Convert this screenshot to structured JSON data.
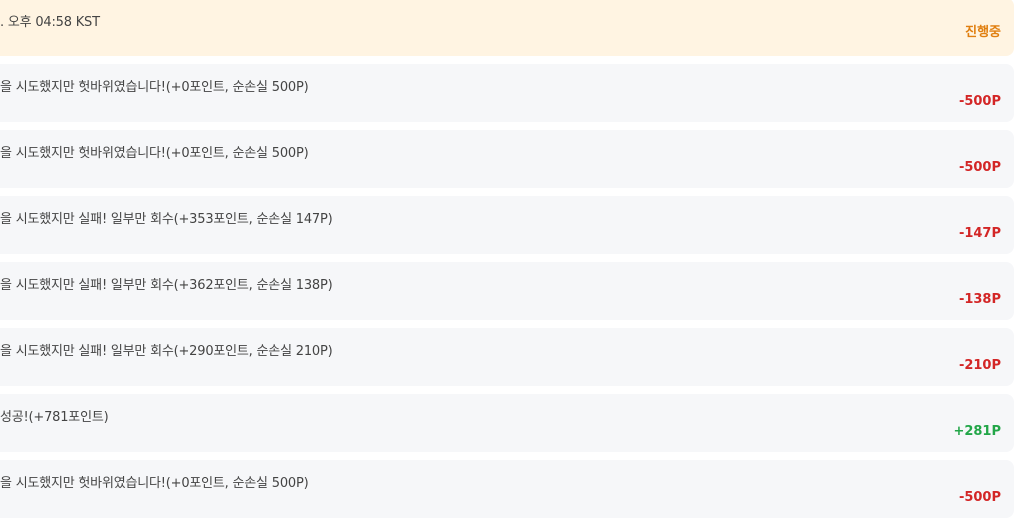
{
  "colors": {
    "status": "#e07f10",
    "negative": "#d32626",
    "positive": "#22a648"
  },
  "header_row": {
    "text": ". 오후 04:58 KST",
    "status": "진행중"
  },
  "history": [
    {
      "text": "을 시도했지만 헛바위였습니다!(+0포인트, 순손실 500P)",
      "delta": "-500P",
      "kind": "negative"
    },
    {
      "text": "을 시도했지만 헛바위였습니다!(+0포인트, 순손실 500P)",
      "delta": "-500P",
      "kind": "negative"
    },
    {
      "text": "을 시도했지만 실패! 일부만 회수(+353포인트, 순손실 147P)",
      "delta": "-147P",
      "kind": "negative"
    },
    {
      "text": "을 시도했지만 실패! 일부만 회수(+362포인트, 순손실 138P)",
      "delta": "-138P",
      "kind": "negative"
    },
    {
      "text": "을 시도했지만 실패! 일부만 회수(+290포인트, 순손실 210P)",
      "delta": "-210P",
      "kind": "negative"
    },
    {
      "text": "성공!(+781포인트)",
      "delta": "+281P",
      "kind": "positive"
    },
    {
      "text": "을 시도했지만 헛바위였습니다!(+0포인트, 순손실 500P)",
      "delta": "-500P",
      "kind": "negative"
    }
  ]
}
